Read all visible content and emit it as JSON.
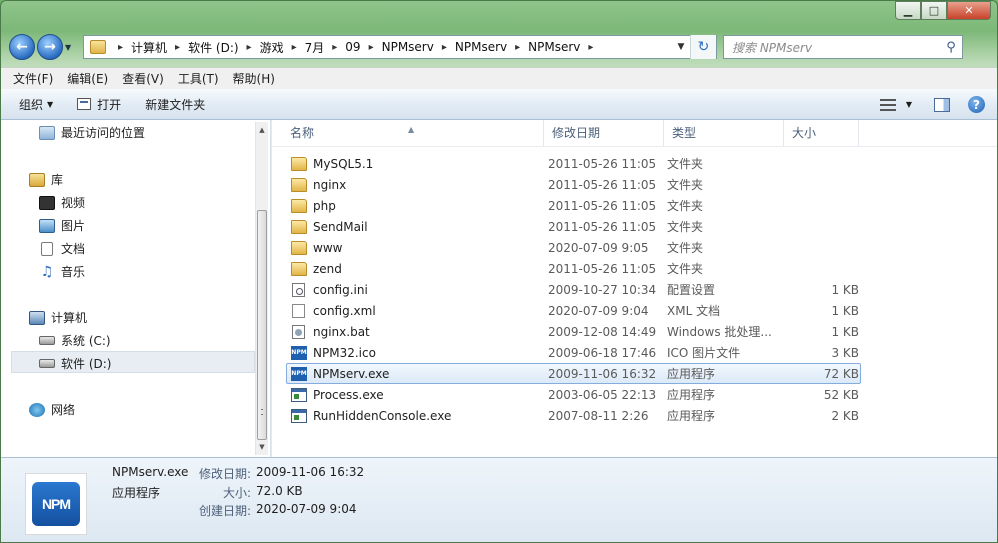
{
  "window": {
    "caption": {
      "minimize": "▁",
      "maximize": "□",
      "close": "✕"
    }
  },
  "nav": {
    "back_icon": "back-arrow-icon",
    "forward_icon": "forward-arrow-icon",
    "breadcrumbs": [
      "计算机",
      "软件 (D:)",
      "游戏",
      "7月",
      "09",
      "NPMserv",
      "NPMserv",
      "NPMserv"
    ],
    "search_placeholder": "搜索 NPMserv"
  },
  "menu": [
    "文件(F)",
    "编辑(E)",
    "查看(V)",
    "工具(T)",
    "帮助(H)"
  ],
  "commands": {
    "organize": "组织",
    "open": "打开",
    "new_folder": "新建文件夹"
  },
  "sidebar": {
    "recent": "最近访问的位置",
    "libraries": "库",
    "video": "视频",
    "pictures": "图片",
    "documents": "文档",
    "music": "音乐",
    "computer": "计算机",
    "drive_c": "系统 (C:)",
    "drive_d": "软件 (D:)",
    "network": "网络"
  },
  "columns": {
    "name": "名称",
    "date": "修改日期",
    "type": "类型",
    "size": "大小"
  },
  "files": [
    {
      "name": "MySQL5.1",
      "date": "2011-05-26 11:05",
      "type": "文件夹",
      "size": "",
      "icon": "folder"
    },
    {
      "name": "nginx",
      "date": "2011-05-26 11:05",
      "type": "文件夹",
      "size": "",
      "icon": "folder"
    },
    {
      "name": "php",
      "date": "2011-05-26 11:05",
      "type": "文件夹",
      "size": "",
      "icon": "folder"
    },
    {
      "name": "SendMail",
      "date": "2011-05-26 11:05",
      "type": "文件夹",
      "size": "",
      "icon": "folder"
    },
    {
      "name": "www",
      "date": "2020-07-09 9:05",
      "type": "文件夹",
      "size": "",
      "icon": "folder"
    },
    {
      "name": "zend",
      "date": "2011-05-26 11:05",
      "type": "文件夹",
      "size": "",
      "icon": "folder"
    },
    {
      "name": "config.ini",
      "date": "2009-10-27 10:34",
      "type": "配置设置",
      "size": "1 KB",
      "icon": "cfg"
    },
    {
      "name": "config.xml",
      "date": "2020-07-09 9:04",
      "type": "XML 文档",
      "size": "1 KB",
      "icon": "doc"
    },
    {
      "name": "nginx.bat",
      "date": "2009-12-08 14:49",
      "type": "Windows 批处理...",
      "size": "1 KB",
      "icon": "bat"
    },
    {
      "name": "NPM32.ico",
      "date": "2009-06-18 17:46",
      "type": "ICO 图片文件",
      "size": "3 KB",
      "icon": "npm"
    },
    {
      "name": "NPMserv.exe",
      "date": "2009-11-06 16:32",
      "type": "应用程序",
      "size": "72 KB",
      "icon": "npm",
      "selected": true
    },
    {
      "name": "Process.exe",
      "date": "2003-06-05 22:13",
      "type": "应用程序",
      "size": "52 KB",
      "icon": "exe"
    },
    {
      "name": "RunHiddenConsole.exe",
      "date": "2007-08-11 2:26",
      "type": "应用程序",
      "size": "2 KB",
      "icon": "exe"
    }
  ],
  "details": {
    "icon_text": "NPM",
    "name": "NPMserv.exe",
    "type": "应用程序",
    "modified_label": "修改日期:",
    "modified_value": "2009-11-06 16:32",
    "size_label": "大小:",
    "size_value": "72.0 KB",
    "created_label": "创建日期:",
    "created_value": "2020-07-09 9:04"
  }
}
